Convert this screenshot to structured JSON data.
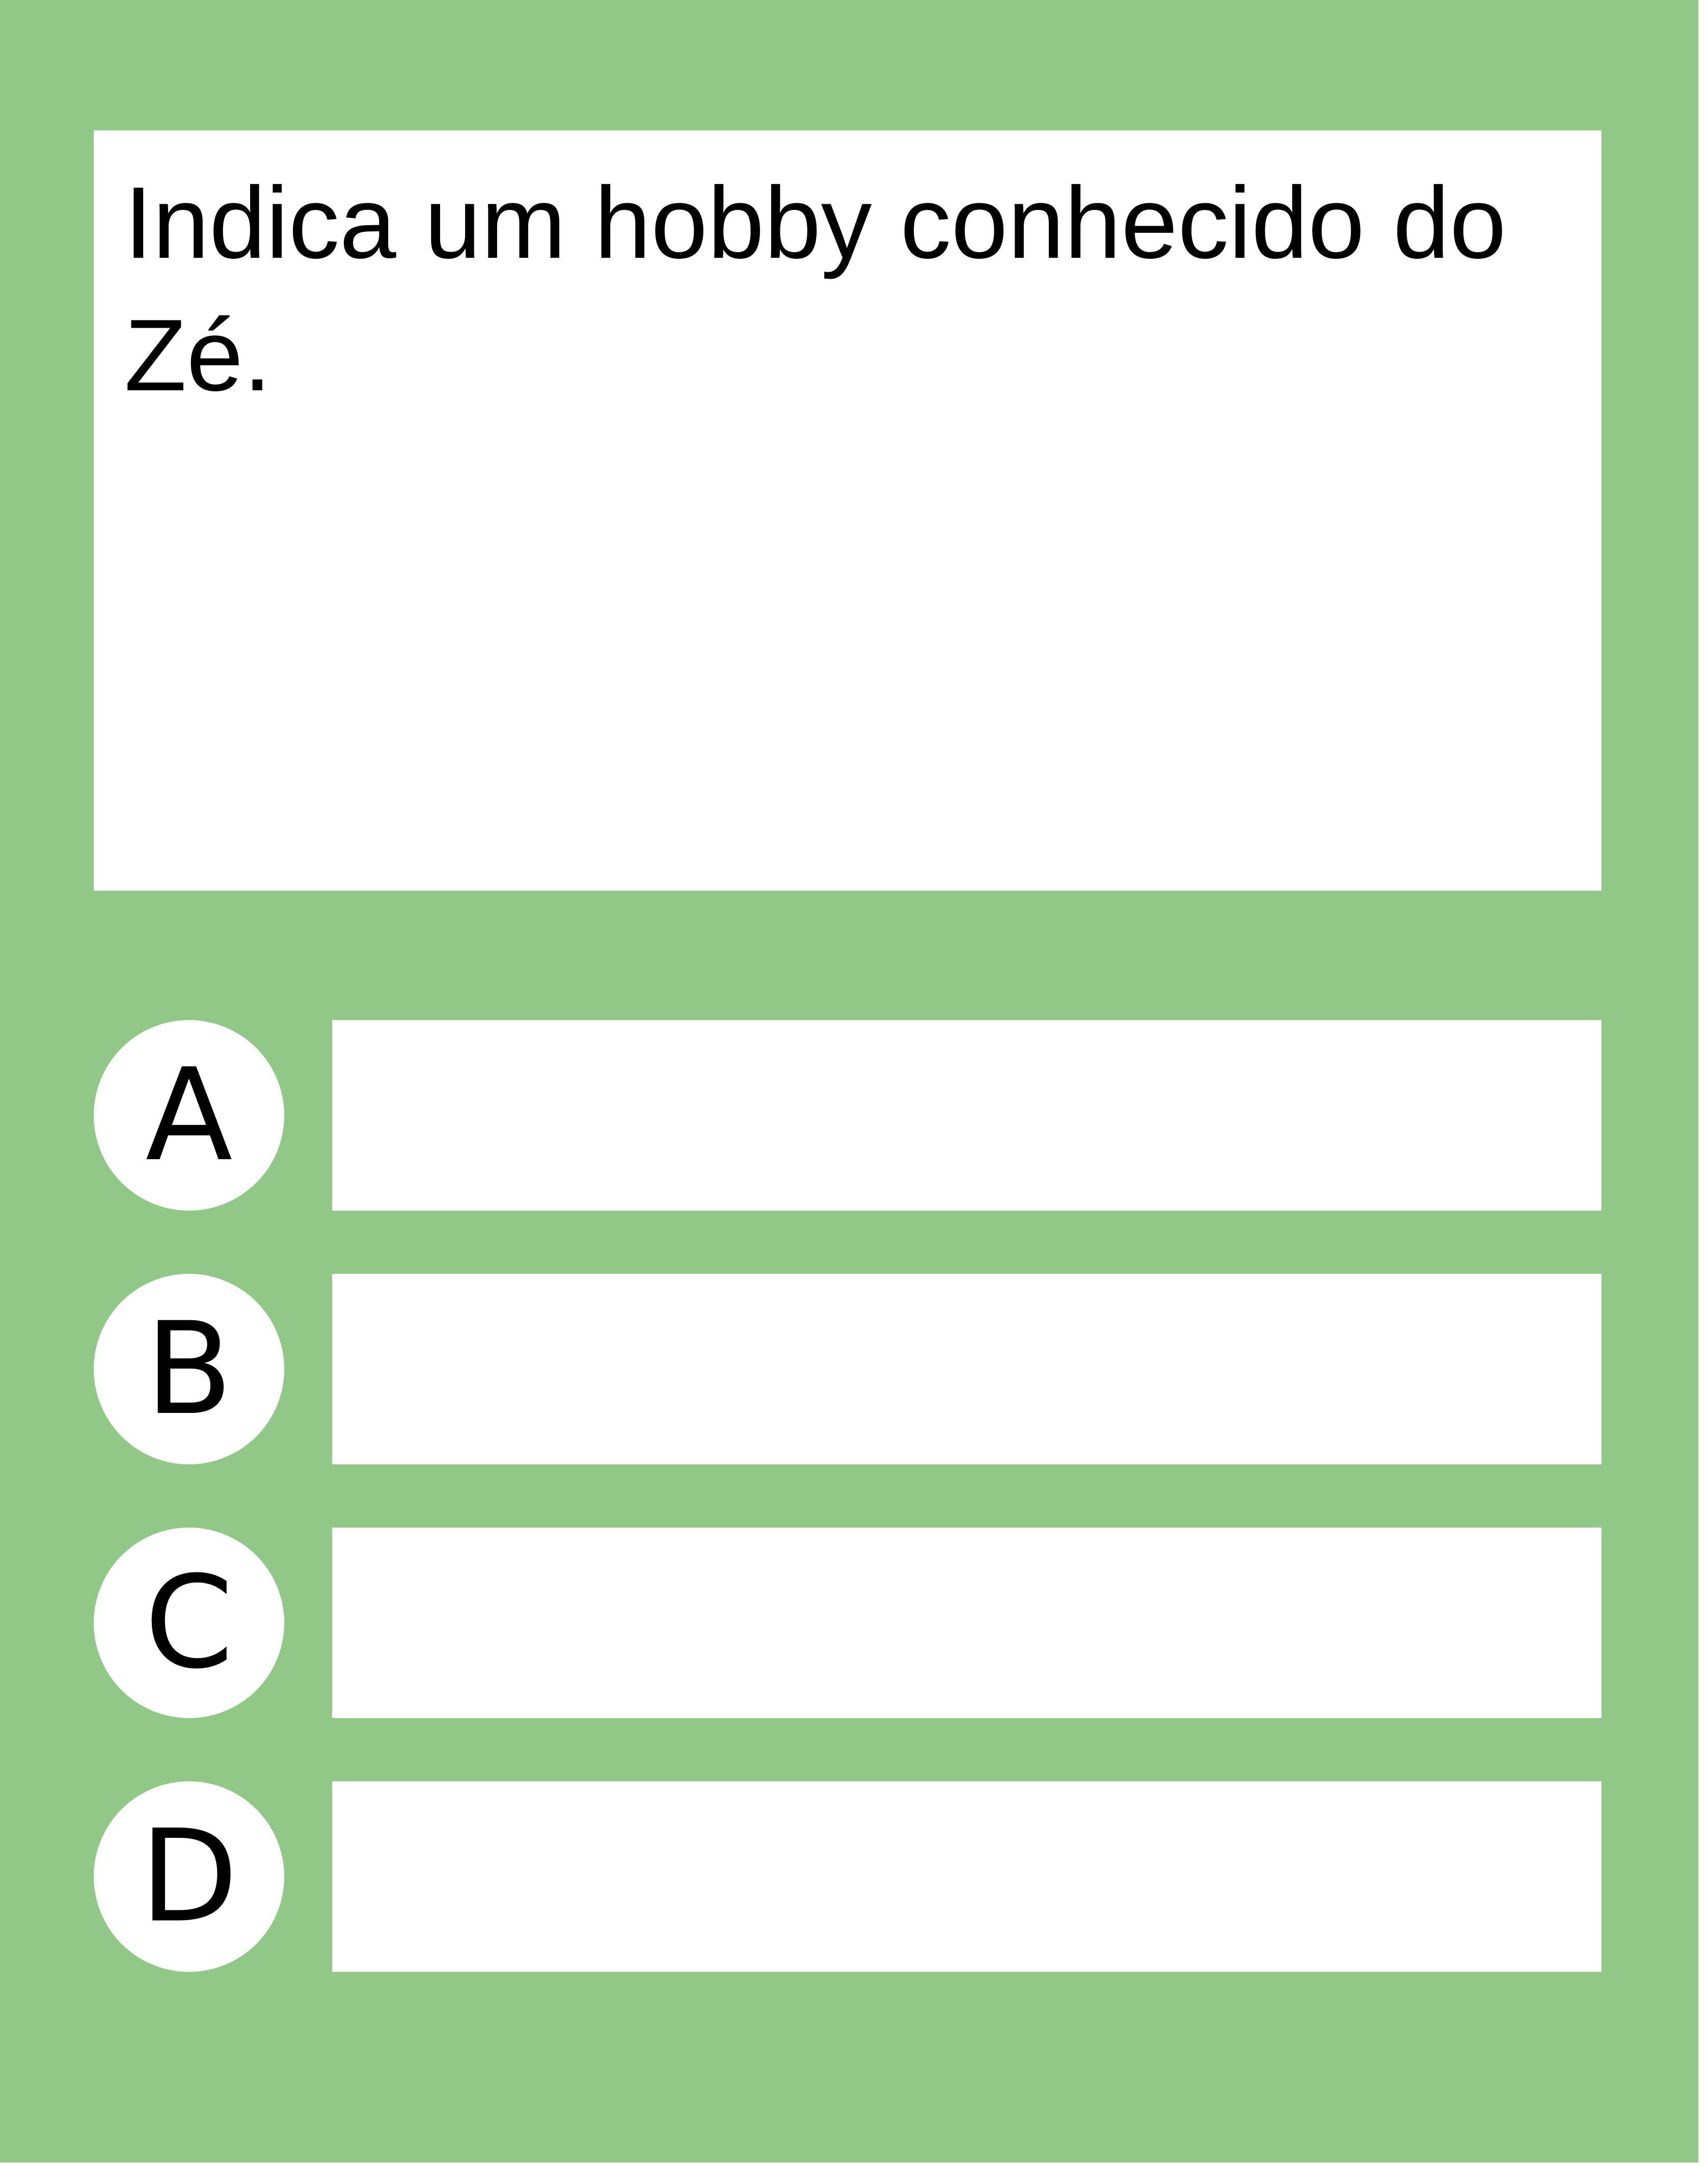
{
  "colors": {
    "card_background": "#92c887",
    "panel_background": "#ffffff",
    "text": "#000000"
  },
  "question": {
    "text": "Indica um hobby conhecido do Zé."
  },
  "options": [
    {
      "letter": "A",
      "answer": ""
    },
    {
      "letter": "B",
      "answer": ""
    },
    {
      "letter": "C",
      "answer": ""
    },
    {
      "letter": "D",
      "answer": ""
    }
  ]
}
